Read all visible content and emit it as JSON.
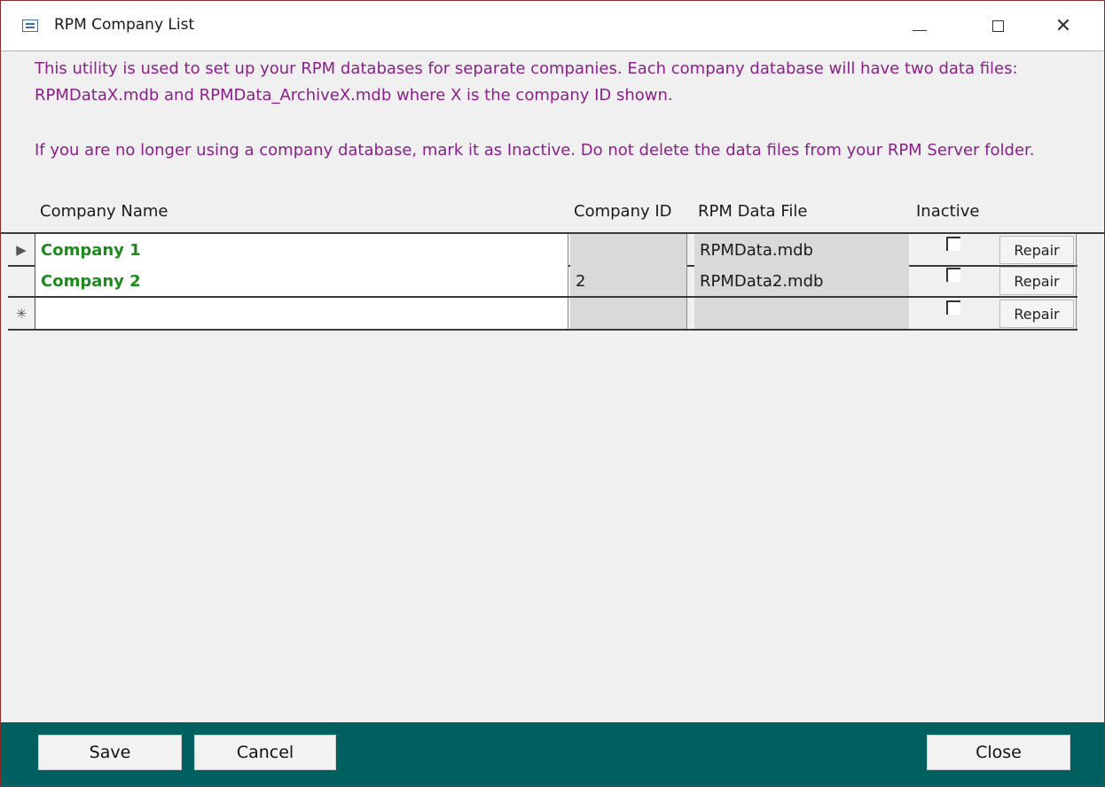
{
  "window": {
    "title": "RPM Company List",
    "minimize": "—",
    "maximize": "",
    "close": "✕"
  },
  "info": {
    "paragraph1": "This utility is used to set up your RPM databases for separate companies. Each company database will have two data files: RPMDataX.mdb and RPMData_ArchiveX.mdb where X is the company ID shown.",
    "paragraph2": "If you are no longer using a company database, mark it as Inactive. Do not delete the data files from your RPM Server folder."
  },
  "table": {
    "headers": {
      "company_name": "Company Name",
      "company_id": "Company ID",
      "data_file": "RPM Data File",
      "inactive": "Inactive"
    },
    "rows": [
      {
        "selector": "▶",
        "name": "Company 1",
        "id": "",
        "file": "RPMData.mdb",
        "inactive": false,
        "repair": "Repair"
      },
      {
        "selector": "",
        "name": "Company 2",
        "id": "2",
        "file": "RPMData2.mdb",
        "inactive": false,
        "repair": "Repair"
      },
      {
        "selector": "✳",
        "name": "",
        "id": "",
        "file": "",
        "inactive": false,
        "repair": "Repair"
      }
    ]
  },
  "footer": {
    "save": "Save",
    "cancel": "Cancel",
    "close": "Close"
  }
}
